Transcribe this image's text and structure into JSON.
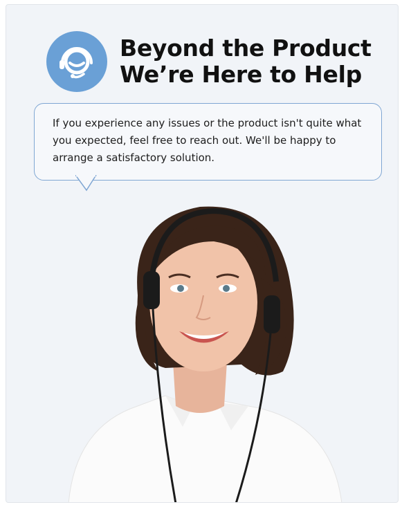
{
  "header": {
    "title_line1": "Beyond the Product",
    "title_line2": "We’re Here to Help",
    "badge_icon": "headset-support-icon",
    "badge_color": "#6aa0d6"
  },
  "bubble": {
    "text": "If you experience any issues or the product isn't quite what you expected, feel free to reach out. We'll be happy to arrange a satisfactory solution.",
    "border_color": "#7fa6d3"
  },
  "photo": {
    "subject": "support-agent-with-headset"
  },
  "colors": {
    "background": "#f1f4f8",
    "text": "#111111"
  }
}
